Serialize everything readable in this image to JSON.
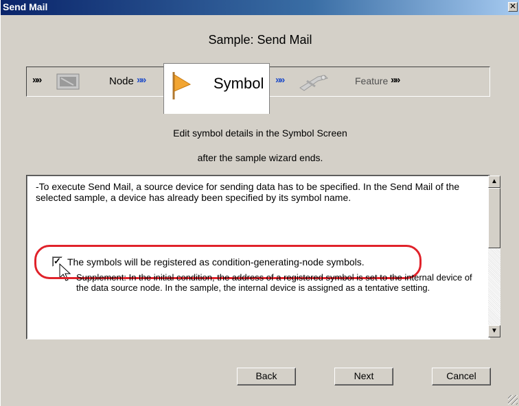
{
  "window": {
    "title": "Send Mail",
    "close_glyph": "✕"
  },
  "wizard": {
    "title": "Sample: Send Mail",
    "steps": [
      {
        "label": "Node",
        "icon": "monitor-icon"
      },
      {
        "label": "Symbol",
        "icon": "flag-icon"
      },
      {
        "label": "Feature",
        "icon": "tools-icon"
      }
    ],
    "arrow_glyph": "»",
    "info_line1": "Edit symbol details in the Symbol Screen",
    "info_line2": "after the sample wizard ends."
  },
  "content": {
    "paragraph": "-To execute Send Mail, a source device for sending data has to be specified. In the Send Mail of the selected sample, a device has already been specified by its symbol name.",
    "checkbox_label": "The symbols will be registered as condition-generating-node symbols.",
    "checkbox_checked": true,
    "supplement": "Supplement: In the initial condition, the address of a registered symbol is set to the internal device of the data source node. In the sample, the internal device is assigned as a tentative setting."
  },
  "buttons": {
    "back": "Back",
    "next": "Next",
    "cancel": "Cancel"
  },
  "colors": {
    "highlight": "#e0222a",
    "arrow_blue": "#1f4cc8",
    "title_bar": "#0a246a"
  }
}
